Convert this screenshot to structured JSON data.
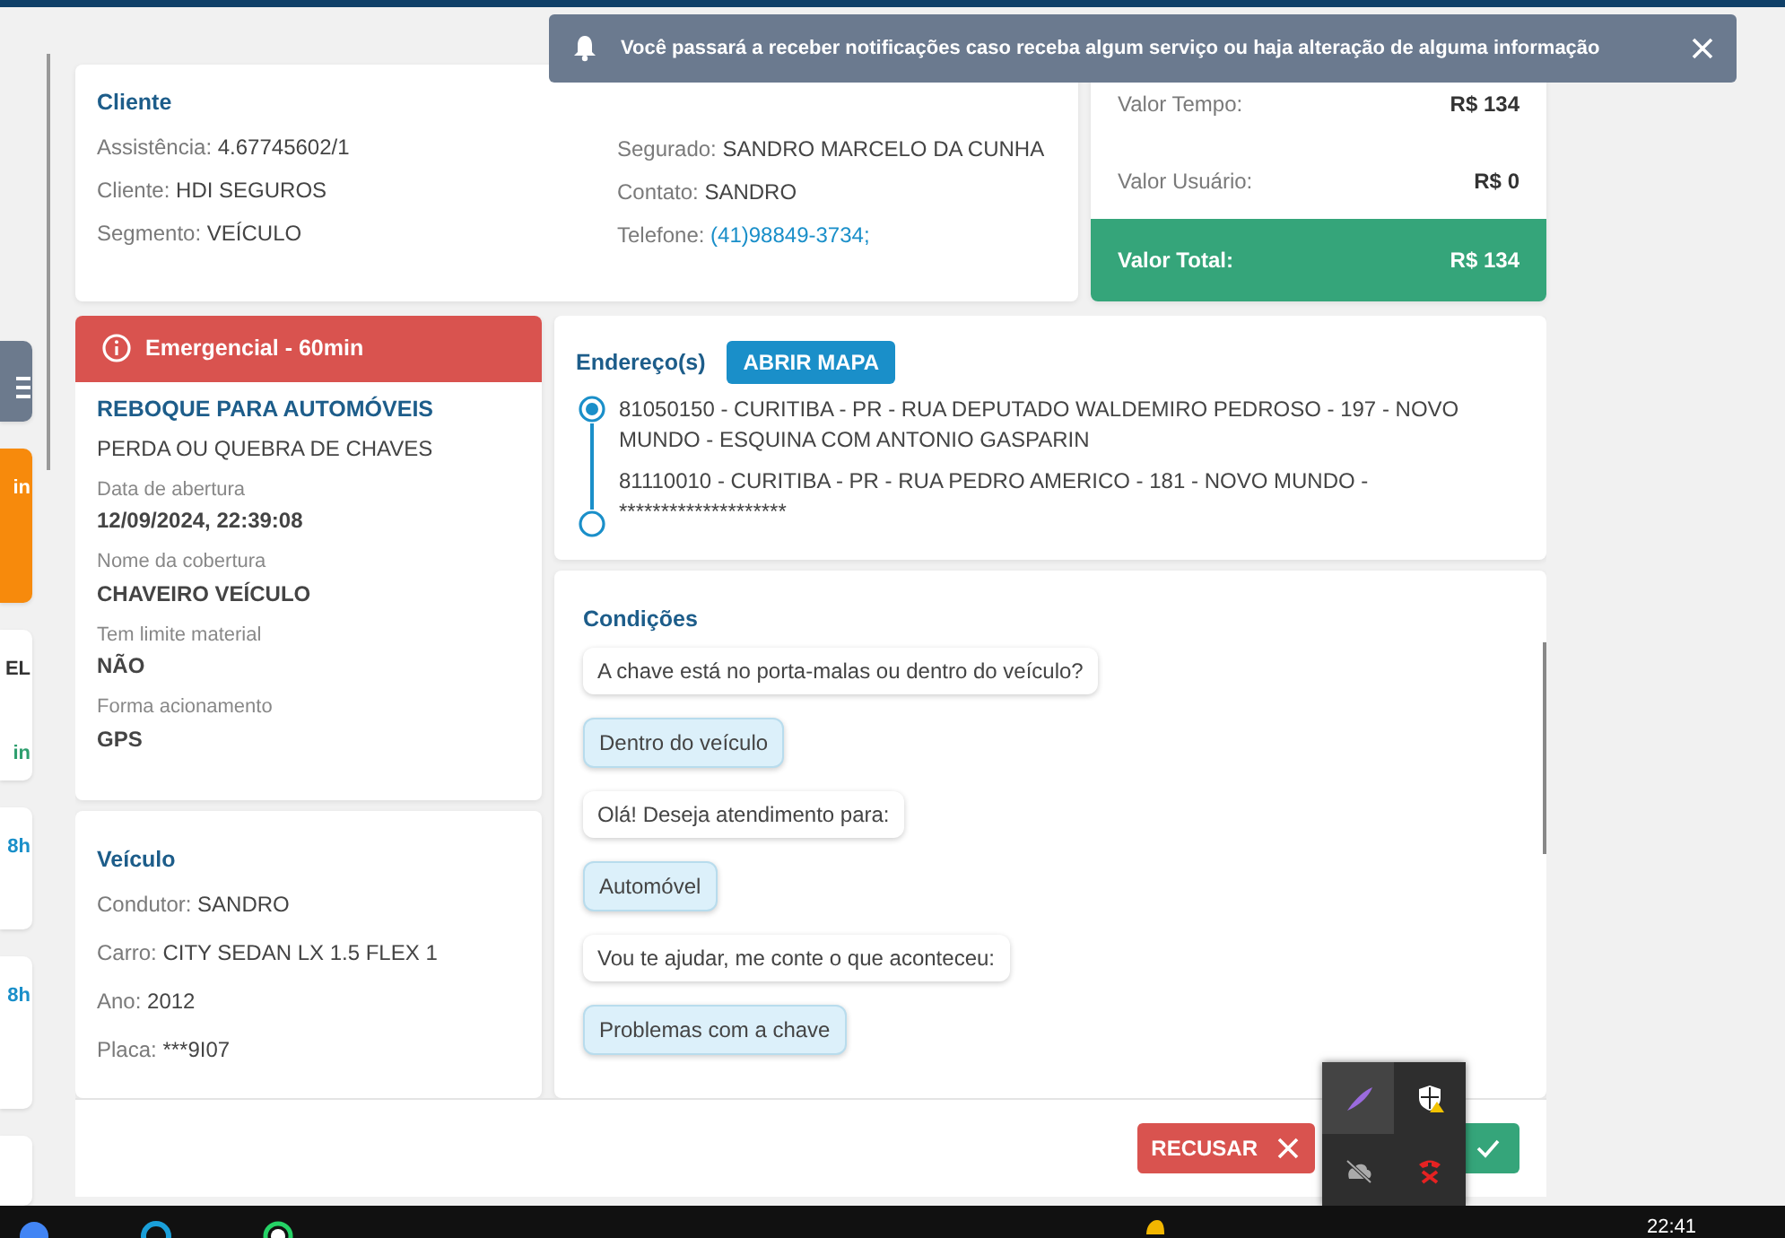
{
  "toast": {
    "text": "Você passará a receber notificações caso receba algum serviço ou haja alteração de alguma informação"
  },
  "sidebar_cards": [
    {
      "kind": "menu"
    },
    {
      "kind": "highlight",
      "texts": [
        {
          "text": "in",
          "color": "#ffffff"
        }
      ]
    },
    {
      "kind": "plain",
      "texts": [
        {
          "text": "EL",
          "color": "#333333"
        },
        {
          "text": "in",
          "color": "#2e9e6e"
        }
      ]
    },
    {
      "kind": "plain",
      "texts": [
        {
          "text": "8h",
          "color": "#1a8fc9"
        }
      ]
    },
    {
      "kind": "plain",
      "texts": [
        {
          "text": "8h",
          "color": "#1a8fc9"
        }
      ]
    },
    {
      "kind": "plain"
    }
  ],
  "cliente": {
    "title": "Cliente",
    "left": [
      {
        "label": "Assistência:",
        "value": "4.67745602/1"
      },
      {
        "label": "Cliente:",
        "value": "HDI SEGUROS"
      },
      {
        "label": "Segmento:",
        "value": "VEÍCULO"
      }
    ],
    "right": [
      {
        "label": "Segurado:",
        "value": "SANDRO MARCELO DA CUNHA"
      },
      {
        "label": "Contato:",
        "value": "SANDRO"
      },
      {
        "label": "Telefone:",
        "value": "(41)98849-3734;",
        "kind": "link"
      }
    ]
  },
  "values": [
    {
      "label": "Valor Tempo:",
      "value": "R$ 134",
      "kind": "plain"
    },
    {
      "label": "Valor Usuário:",
      "value": "R$ 0",
      "kind": "plain"
    },
    {
      "label": "Valor Total:",
      "value": "R$ 134",
      "kind": "total"
    }
  ],
  "service": {
    "badge": "Emergencial - 60min",
    "title": "REBOQUE PARA AUTOMÓVEIS",
    "subtitle": "PERDA OU QUEBRA DE CHAVES",
    "details": [
      {
        "label": "Data de abertura",
        "value": "12/09/2024, 22:39:08"
      },
      {
        "label": "Nome da cobertura",
        "value": "CHAVEIRO VEÍCULO"
      },
      {
        "label": "Tem limite material",
        "value": "NÃO"
      },
      {
        "label": "Forma acionamento",
        "value": "GPS"
      }
    ]
  },
  "vehicle": {
    "title": "Veículo",
    "fields": [
      {
        "label": "Condutor:",
        "value": "SANDRO"
      },
      {
        "label": "Carro:",
        "value": "CITY SEDAN LX 1.5 FLEX 1"
      },
      {
        "label": "Ano:",
        "value": "2012"
      },
      {
        "label": "Placa:",
        "value": "***9I07"
      }
    ]
  },
  "addresses": {
    "title": "Endereço(s)",
    "button": "ABRIR MAPA",
    "items": [
      {
        "text": "81050150 - CURITIBA - PR - RUA DEPUTADO WALDEMIRO PEDROSO - 197 - NOVO MUNDO - ESQUINA COM ANTONIO GASPARIN",
        "kind": "origin"
      },
      {
        "text": "81110010 - CURITIBA - PR - RUA PEDRO AMERICO - 181 - NOVO MUNDO - ********************",
        "kind": "destination"
      }
    ]
  },
  "conditions": {
    "title": "Condições",
    "messages": [
      {
        "text": "A chave está no porta-malas ou dentro do veículo?",
        "kind": "question"
      },
      {
        "text": "Dentro do veículo",
        "kind": "answer"
      },
      {
        "text": "Olá! Deseja atendimento para:",
        "kind": "question"
      },
      {
        "text": "Automóvel",
        "kind": "answer"
      },
      {
        "text": "Vou te ajudar, me conte o que aconteceu:",
        "kind": "question"
      },
      {
        "text": "Problemas com a chave",
        "kind": "answer"
      }
    ]
  },
  "footer": {
    "reject": "RECUSAR"
  },
  "taskbar": {
    "time": "22:41"
  }
}
